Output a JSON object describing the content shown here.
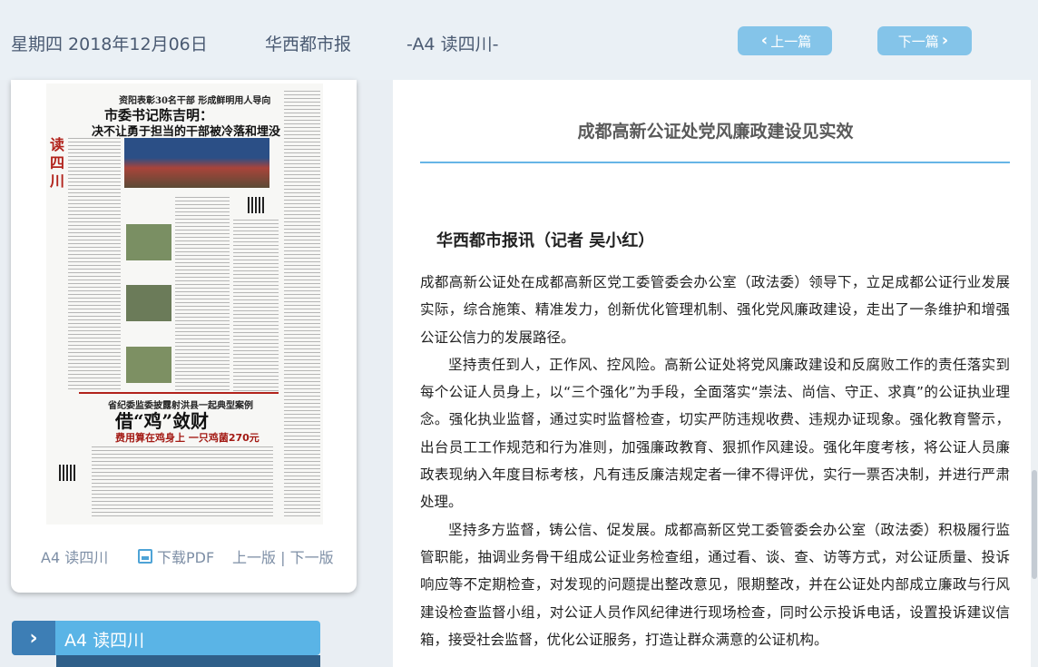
{
  "header": {
    "date": "星期四 2018年12月06日",
    "paper_name": "华西都市报",
    "section": "-A4 读四川-",
    "prev_label": "上一篇",
    "next_label": "下一篇"
  },
  "thumbnail": {
    "top_line": "资阳表彰30名干部 形成鲜明用人导向",
    "headline_1": "市委书记陈吉明：",
    "headline_2": "决不让勇于担当的干部被冷落和埋没",
    "vertical_title": "读四川",
    "lower_sub": "省纪委监委披露射洪县一起典型案例",
    "lower_head": "借“鸡”敛财",
    "lower_sub2": "费用算在鸡身上 一只鸡菌270元"
  },
  "card_footer": {
    "page_label": "A4 读四川",
    "download_pdf": "下载PDF",
    "prev_page": "上一版",
    "separator": "|",
    "next_page": "下一版"
  },
  "section_tab": {
    "label": "A4  读四川"
  },
  "article": {
    "title": "成都高新公证处党风廉政建设见实效",
    "byline": "华西都市报讯（记者 吴小红）",
    "paragraphs": [
      "成都高新公证处在成都高新区党工委管委会办公室（政法委）领导下，立足成都公证行业发展实际，综合施策、精准发力，创新优化管理机制、强化党风廉政建设，走出了一条维护和增强公证公信力的发展路径。",
      "坚持责任到人，正作风、控风险。高新公证处将党风廉政建设和反腐败工作的责任落实到每个公证人员身上，以“三个强化”为手段，全面落实“崇法、尚信、守正、求真”的公证执业理念。强化执业监督，通过实时监督检查，切实严防违规收费、违规办证现象。强化教育警示，出台员工工作规范和行为准则，加强廉政教育、狠抓作风建设。强化年度考核，将公证人员廉政表现纳入年度目标考核，凡有违反廉洁规定者一律不得评优，实行一票否决制，并进行严肃处理。",
      "坚持多方监督，铸公信、促发展。成都高新区党工委管委会办公室（政法委）积极履行监管职能，抽调业务骨干组成公证业务检查组，通过看、谈、查、访等方式，对公证质量、投诉响应等不定期检查，对发现的问题提出整改意见，限期整改，并在公证处内部成立廉政与行风建设检查监督小组，对公证人员作风纪律进行现场检查，同时公示投诉电话，设置投诉建议信箱，接受社会监督，优化公证服务，打造让群众满意的公证机构。"
    ]
  }
}
